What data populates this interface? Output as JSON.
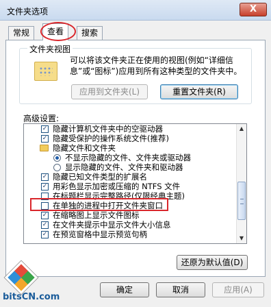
{
  "window": {
    "title": "文件夹选项",
    "close_glyph": "X"
  },
  "tabs": [
    {
      "label": "常规"
    },
    {
      "label": "查看",
      "active": true
    },
    {
      "label": "搜索"
    }
  ],
  "folder_views": {
    "legend": "文件夹视图",
    "description": "可以将该文件夹正在使用的视图(例如“详细信息”或“图标”)应用到所有这种类型的文件夹中。",
    "apply_button": "应用到文件夹(L)",
    "reset_button": "重置文件夹(R)"
  },
  "advanced": {
    "label": "高级设置:",
    "items": [
      {
        "type": "checkbox",
        "checked": true,
        "label": "隐藏计算机文件夹中的空驱动器"
      },
      {
        "type": "checkbox",
        "checked": true,
        "label": "隐藏受保护的操作系统文件(推荐)"
      },
      {
        "type": "folder",
        "label": "隐藏文件和文件夹"
      },
      {
        "type": "radio",
        "checked": true,
        "label": "不显示隐藏的文件、文件夹或驱动器"
      },
      {
        "type": "radio",
        "checked": false,
        "label": "显示隐藏的文件、文件夹和驱动器"
      },
      {
        "type": "checkbox",
        "checked": true,
        "label": "隐藏已知文件类型的扩展名"
      },
      {
        "type": "checkbox",
        "checked": true,
        "label": "用彩色显示加密或压缩的 NTFS 文件"
      },
      {
        "type": "checkbox",
        "checked": false,
        "label": "在标题栏显示完整路径(仅限经典主题)"
      },
      {
        "type": "checkbox",
        "checked": false,
        "label": "在单独的进程中打开文件夹窗口"
      },
      {
        "type": "checkbox",
        "checked": true,
        "label": "在缩略图上显示文件图标"
      },
      {
        "type": "checkbox",
        "checked": true,
        "label": "在文件夹提示中显示文件大小信息"
      },
      {
        "type": "checkbox",
        "checked": true,
        "label": "在预览窗格中显示预览句柄"
      }
    ],
    "restore_defaults_button": "还原为默认值(D)"
  },
  "footer": {
    "ok": "确定",
    "cancel": "取消",
    "apply": "应用(A)"
  },
  "watermark": {
    "text": "bitsCN.com"
  },
  "colors": {
    "annotation_red": "#d9262b",
    "titlebar": "#dfe9f5"
  }
}
